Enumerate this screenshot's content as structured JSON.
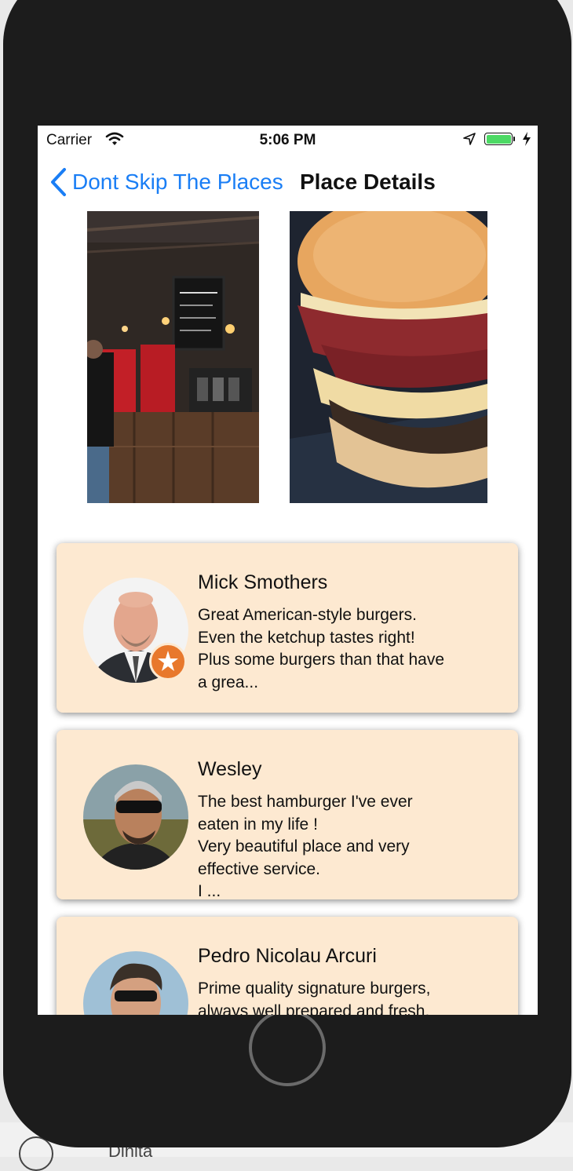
{
  "status_bar": {
    "carrier": "Carrier",
    "time": "5:06 PM",
    "icons": [
      "wifi-icon",
      "location-arrow-icon",
      "battery-icon",
      "charging-bolt-icon"
    ],
    "battery_color": "#4cd964"
  },
  "nav": {
    "back_label": "Dont Skip The Places",
    "title": "Place Details",
    "accent_color": "#1a7ef5"
  },
  "photos": [
    {
      "subject": "restaurant-counter"
    },
    {
      "subject": "burger-closeup"
    }
  ],
  "reviews": [
    {
      "name": "Mick Smothers",
      "text": "Great American-style burgers.\nEven the ketchup tastes right!\nPlus some burgers than that have\na grea...",
      "has_badge": true
    },
    {
      "name": "Wesley",
      "text": "The best hamburger I've ever\neaten in my life !\nVery beautiful place and very\neffective service.\nI ...",
      "has_badge": false
    },
    {
      "name": "Pedro Nicolau Arcuri",
      "text": "Prime quality signature burgers,\nalways well prepared and fresh.",
      "has_badge": false
    }
  ],
  "card_color": "#fde9d1",
  "badge_color": "#e8782c",
  "desktop": {
    "partial_label": "Dinita"
  }
}
